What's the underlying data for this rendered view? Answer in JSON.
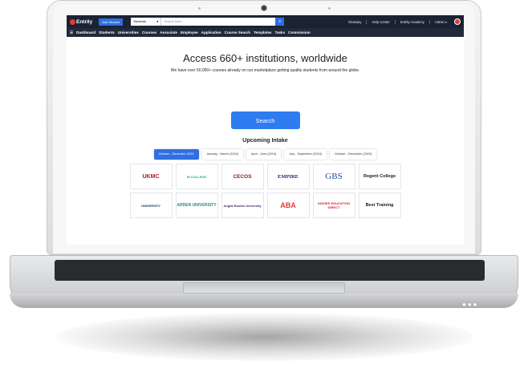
{
  "app": {
    "brand": "Entrily",
    "add_button": "Add Student",
    "search": {
      "scope": "Students",
      "placeholder": "Search here..."
    },
    "top_links": [
      "Glossary",
      "Help Center",
      "Entrily Academy",
      "Admin"
    ],
    "nav_items": [
      "Dashboard",
      "Students",
      "Universities",
      "Courses",
      "Associate",
      "Employee",
      "Application",
      "Course Search",
      "Templates",
      "Tasks",
      "Commission"
    ]
  },
  "hero": {
    "title": "Access 660+ institutions, worldwide",
    "subtitle": "We have over 50,000+ courses already on our marketplace getting quality students from around the globe.",
    "search_button": "Search"
  },
  "intake": {
    "title": "Upcoming Intake",
    "tabs": [
      "October - December 2023",
      "January - March (2024)",
      "April - June (2024)",
      "July - September (2024)",
      "October - December (2024)"
    ],
    "active_tab": 0
  },
  "institutions": [
    {
      "name": "UKMC",
      "color": "#b0182b"
    },
    {
      "name": "IN COLLEGE",
      "color": "#19a89a"
    },
    {
      "name": "CECOS",
      "color": "#8a1b1b"
    },
    {
      "name": "EMPIRE",
      "color": "#1a2f6b"
    },
    {
      "name": "GBS",
      "color": "#1f4e9c"
    },
    {
      "name": "Regent College",
      "color": "#1b1b1b"
    },
    {
      "name": "UNIVERSITY",
      "color": "#1a2f6b"
    },
    {
      "name": "ARDEN UNIVERSITY",
      "color": "#2b8a7e"
    },
    {
      "name": "Anglia Ruskin University",
      "color": "#4b2a6b"
    },
    {
      "name": "ABA",
      "color": "#e53935"
    },
    {
      "name": "HIGHER EDUCATION DIRECT",
      "color": "#d8262e"
    },
    {
      "name": "Best Training",
      "color": "#1b1b1b"
    }
  ]
}
